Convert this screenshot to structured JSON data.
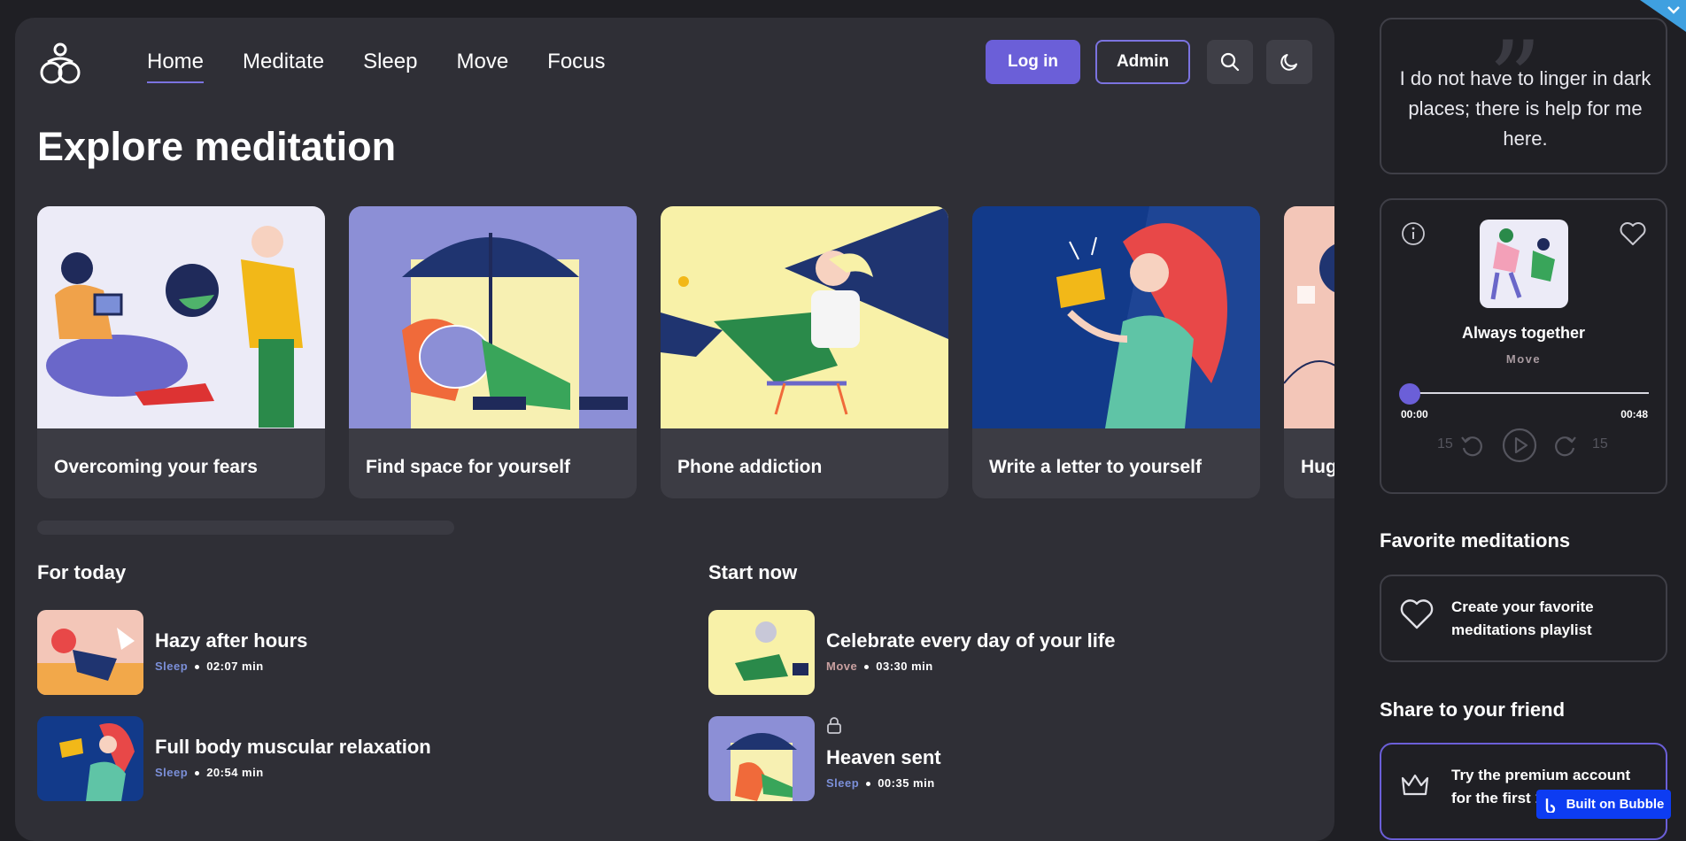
{
  "nav": {
    "items": [
      "Home",
      "Meditate",
      "Sleep",
      "Move",
      "Focus"
    ],
    "login_label": "Log in",
    "admin_label": "Admin"
  },
  "page_title": "Explore meditation",
  "cards": [
    {
      "label": "Overcoming your fears"
    },
    {
      "label": "Find space for yourself"
    },
    {
      "label": "Phone addiction"
    },
    {
      "label": "Write a letter to yourself"
    },
    {
      "label": "Hug"
    }
  ],
  "for_today": {
    "title": "For today",
    "items": [
      {
        "title": "Hazy after hours",
        "tag": "Sleep",
        "duration": "02:07 min"
      },
      {
        "title": "Full body muscular relaxation",
        "tag": "Sleep",
        "duration": "20:54 min"
      }
    ]
  },
  "start_now": {
    "title": "Start now",
    "items": [
      {
        "title": "Celebrate every day of your life",
        "tag": "Move",
        "duration": "03:30 min"
      },
      {
        "title": "Heaven sent",
        "tag": "Sleep",
        "duration": "00:35 min"
      }
    ]
  },
  "quote": {
    "text": "I do not have to linger in dark places; there is help for me here."
  },
  "player": {
    "title": "Always together",
    "category": "Move",
    "elapsed": "00:00",
    "total": "00:48",
    "back_seconds": "15",
    "forward_seconds": "15",
    "progress": 0
  },
  "favorites": {
    "title": "Favorite meditations",
    "cta": "Create your favorite meditations playlist"
  },
  "share": {
    "title": "Share to your friend",
    "cta": "Try the premium account for the first 1"
  },
  "badge": {
    "label": "Built on Bubble"
  },
  "colors": {
    "accent": "#6b5fd8",
    "sleep_tag": "#7b8fd8",
    "move_tag": "#c9a0a0"
  }
}
